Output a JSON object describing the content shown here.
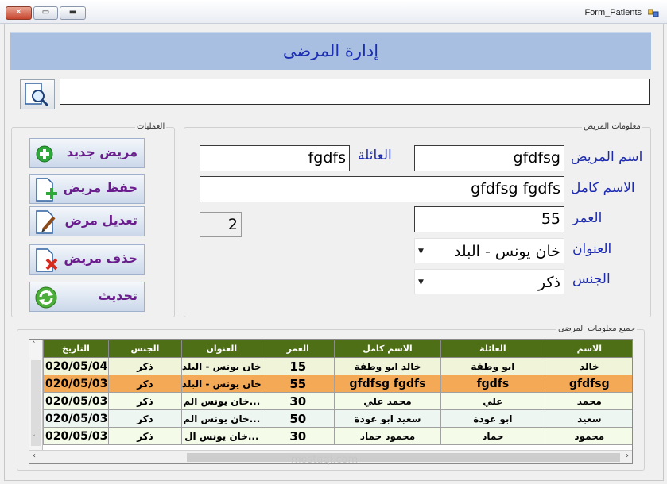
{
  "window": {
    "title": "Form_Patients",
    "close_glyph": "✕",
    "maximize_glyph": "▭",
    "minimize_glyph": "▬"
  },
  "header": {
    "title": "إدارة المرضى"
  },
  "search": {
    "value": "",
    "icon": "search-document-icon"
  },
  "operations": {
    "group_title": "العمليات",
    "buttons": [
      {
        "label": "مريض جديد",
        "icon": "green-plus-icon"
      },
      {
        "label": "حفظ مريض",
        "icon": "document-add-icon"
      },
      {
        "label": "تعديل مرض",
        "icon": "document-edit-icon"
      },
      {
        "label": "حذف مريض",
        "icon": "document-delete-icon"
      },
      {
        "label": "تحديث",
        "icon": "green-refresh-icon"
      }
    ]
  },
  "patient_info": {
    "group_title": "معلومات المريض",
    "name_label": "اسم المريض",
    "name_value": "gfdfsg",
    "family_label": "العائلة",
    "family_value": "fgdfs",
    "fullname_label": "الاسم كامل",
    "fullname_value": "gfdfsg fgdfs",
    "age_label": "العمر",
    "age_value": "55",
    "id_value": "2",
    "address_label": "العنوان",
    "address_value": "خان يونس - البلد",
    "gender_label": "الجنس",
    "gender_value": "ذكر"
  },
  "grid": {
    "group_title": "جميع معلومات المرضى",
    "columns": [
      "التاريخ",
      "الجنس",
      "العنوان",
      "العمر",
      "الاسم كامل",
      "العائلة",
      "الاسم"
    ],
    "rows": [
      [
        "020/05/04",
        "ذكر",
        "خان يونس - البلد",
        "15",
        "خالد ابو وطفة",
        "ابو وطفة",
        "خالد"
      ],
      [
        "020/05/03",
        "ذكر",
        "خان يونس - البلد",
        "55",
        "gfdfsg fgdfs",
        "fgdfs",
        "gfdfsg"
      ],
      [
        "020/05/03",
        "ذكر",
        "خان يونس الم...",
        "30",
        "محمد علي",
        "علي",
        "محمد"
      ],
      [
        "020/05/03",
        "ذكر",
        "خان يونس الم...",
        "50",
        "سعيد ابو عودة",
        "ابو عودة",
        "سعيد"
      ],
      [
        "020/05/03",
        "ذكر",
        "خان يونس ال...",
        "30",
        "محمود حماد",
        "حماد",
        "محمود"
      ]
    ],
    "selected_row": 1
  },
  "colors": {
    "header_band": "#a9bfe1",
    "grid_header": "#4f6f16",
    "selected_row": "#f4a956",
    "label_blue": "#1d2bb0",
    "button_text": "#6a1d8c"
  },
  "watermark": "mostaqi.com"
}
